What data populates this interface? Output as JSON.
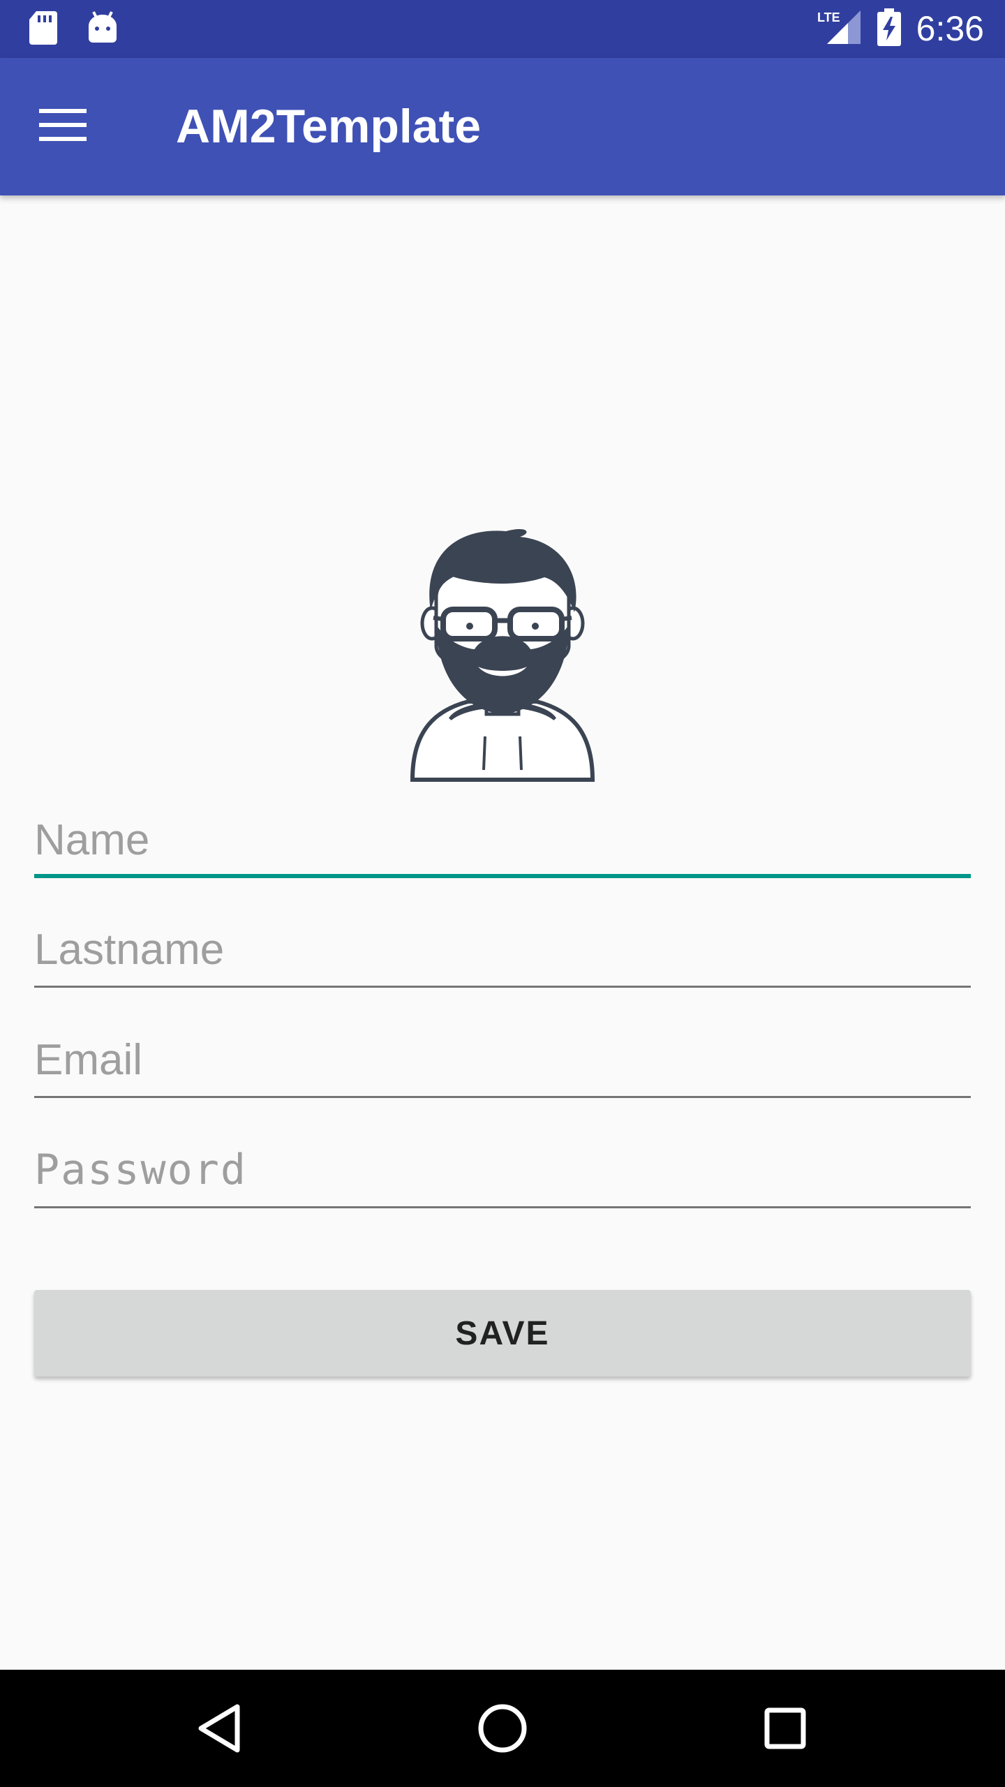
{
  "status_bar": {
    "time": "6:36",
    "network_label": "LTE",
    "icons": [
      "sd-card-icon",
      "android-icon",
      "lte-signal-icon",
      "battery-charging-icon"
    ]
  },
  "app_bar": {
    "title": "AM2Template",
    "menu_icon": "hamburger-menu-icon"
  },
  "avatar": {
    "icon": "bearded-man-avatar-icon"
  },
  "form": {
    "name_placeholder": "Name",
    "lastname_placeholder": "Lastname",
    "email_placeholder": "Email",
    "password_placeholder": "Password",
    "name_value": "",
    "lastname_value": "",
    "email_value": "",
    "password_value": ""
  },
  "actions": {
    "save_label": "SAVE"
  },
  "nav_bar": {
    "icons": [
      "back-icon",
      "home-icon",
      "recents-icon"
    ]
  },
  "colors": {
    "status_bar": "#303f9f",
    "app_bar": "#3f51b5",
    "accent": "#009688",
    "background": "#fafafa",
    "button": "#d6d7d7"
  }
}
